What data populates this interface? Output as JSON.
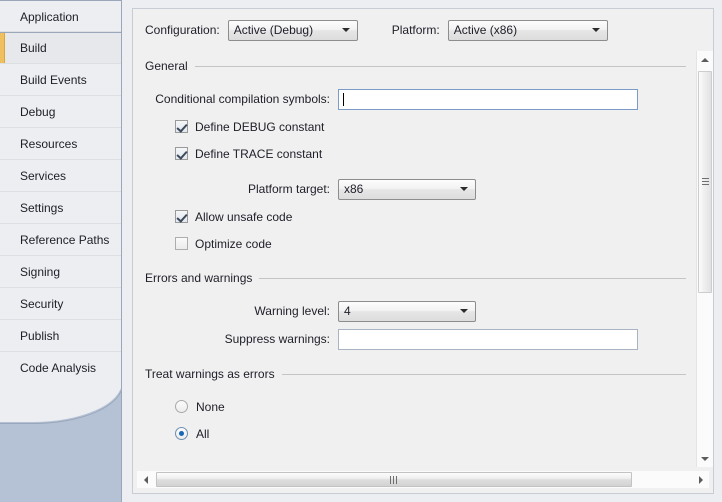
{
  "sidebar": {
    "items": [
      {
        "label": "Application",
        "selected": false
      },
      {
        "label": "Build",
        "selected": true
      },
      {
        "label": "Build Events",
        "selected": false
      },
      {
        "label": "Debug",
        "selected": false
      },
      {
        "label": "Resources",
        "selected": false
      },
      {
        "label": "Services",
        "selected": false
      },
      {
        "label": "Settings",
        "selected": false
      },
      {
        "label": "Reference Paths",
        "selected": false
      },
      {
        "label": "Signing",
        "selected": false
      },
      {
        "label": "Security",
        "selected": false
      },
      {
        "label": "Publish",
        "selected": false
      },
      {
        "label": "Code Analysis",
        "selected": false
      }
    ],
    "selected_accent_color": "#f0c060"
  },
  "top_bar": {
    "configuration_label": "Configuration:",
    "configuration_value": "Active (Debug)",
    "platform_label": "Platform:",
    "platform_value": "Active (x86)"
  },
  "general": {
    "group_title": "General",
    "conditional_label": "Conditional compilation symbols:",
    "conditional_value": "",
    "define_debug_label": "Define DEBUG constant",
    "define_debug_checked": true,
    "define_trace_label": "Define TRACE constant",
    "define_trace_checked": true,
    "platform_target_label": "Platform target:",
    "platform_target_value": "x86",
    "allow_unsafe_label": "Allow unsafe code",
    "allow_unsafe_checked": true,
    "optimize_label": "Optimize code",
    "optimize_checked": false
  },
  "errors_warnings": {
    "group_title": "Errors and warnings",
    "warning_level_label": "Warning level:",
    "warning_level_value": "4",
    "suppress_label": "Suppress warnings:",
    "suppress_value": ""
  },
  "treat_warnings": {
    "group_title": "Treat warnings as errors",
    "none_label": "None",
    "none_selected": false,
    "all_label": "All",
    "all_selected": true
  },
  "scrollbars": {
    "vertical_up_icon": "triangle-up-icon",
    "vertical_down_icon": "triangle-down-icon",
    "horizontal_left_icon": "triangle-left-icon",
    "horizontal_right_icon": "triangle-right-icon"
  },
  "colors": {
    "window_background": "#b5c2d6",
    "panel_background": "#f0f0f0",
    "sidebar_background": "#eceef1",
    "accent": "#f0c060",
    "radio_dot": "#1667b5",
    "focus_border": "#7a9cc6"
  }
}
